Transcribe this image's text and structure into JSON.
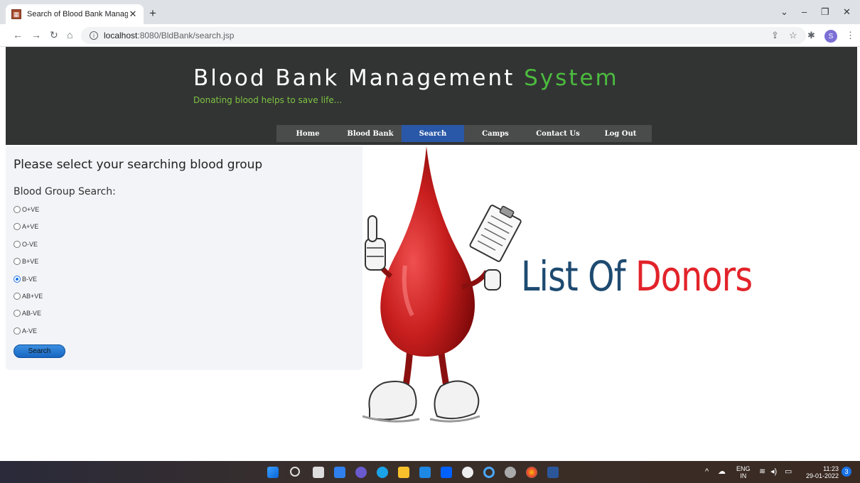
{
  "browser": {
    "tab_title": "Search of Blood Bank Manageme",
    "new_tab": "+",
    "url_host": "localhost",
    "url_path": ":8080/BldBank/search.jsp",
    "profile_initial": "S"
  },
  "site": {
    "title_main": "Blood Bank Management",
    "title_accent": "System",
    "tagline": "Donating blood helps to save life..."
  },
  "menu": [
    "Home",
    "Blood Bank",
    "Search",
    "Camps",
    "Contact Us",
    "Log Out"
  ],
  "menu_active": "Search",
  "form": {
    "heading": "Please select your searching blood group",
    "label": "Blood Group Search:",
    "options": [
      "O+VE",
      "A+VE",
      "O-VE",
      "B+VE",
      "B-VE",
      "AB+VE",
      "AB-VE",
      "A-VE"
    ],
    "selected": "B-VE",
    "button": "Search"
  },
  "banner": {
    "text_1": "List Of",
    "text_2": "Donors"
  },
  "taskbar": {
    "lang_1": "ENG",
    "lang_2": "IN",
    "time": "11:23",
    "date": "29-01-2022",
    "notifications": "3"
  },
  "colors": {
    "header_bg": "#323433",
    "accent_green": "#4cbb3f",
    "menu_active": "#2a58a8",
    "donors_red": "#e2232a",
    "donors_blue": "#1e4a70"
  }
}
